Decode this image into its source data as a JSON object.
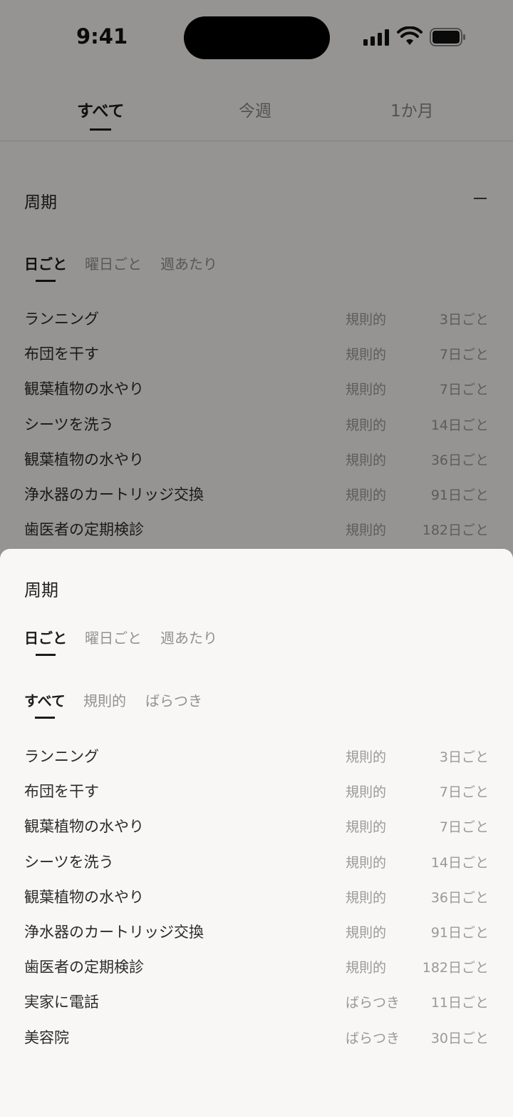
{
  "status_bar": {
    "time": "9:41"
  },
  "top_tabs": [
    {
      "label": "すべて",
      "active": true
    },
    {
      "label": "今週",
      "active": false
    },
    {
      "label": "1か月",
      "active": false
    }
  ],
  "background": {
    "section_title": "周期",
    "sub_tabs": [
      {
        "label": "日ごと",
        "active": true
      },
      {
        "label": "曜日ごと",
        "active": false
      },
      {
        "label": "週あたり",
        "active": false
      }
    ],
    "items": [
      {
        "name": "ランニング",
        "kind": "規則的",
        "interval": "3日ごと"
      },
      {
        "name": "布団を干す",
        "kind": "規則的",
        "interval": "7日ごと"
      },
      {
        "name": "観葉植物の水やり",
        "kind": "規則的",
        "interval": "7日ごと"
      },
      {
        "name": "シーツを洗う",
        "kind": "規則的",
        "interval": "14日ごと"
      },
      {
        "name": "観葉植物の水やり",
        "kind": "規則的",
        "interval": "36日ごと"
      },
      {
        "name": "浄水器のカートリッジ交換",
        "kind": "規則的",
        "interval": "91日ごと"
      },
      {
        "name": "歯医者の定期検診",
        "kind": "規則的",
        "interval": "182日ごと"
      }
    ]
  },
  "sheet": {
    "title": "周期",
    "period_tabs": [
      {
        "label": "日ごと",
        "active": true
      },
      {
        "label": "曜日ごと",
        "active": false
      },
      {
        "label": "週あたり",
        "active": false
      }
    ],
    "filter_tabs": [
      {
        "label": "すべて",
        "active": true
      },
      {
        "label": "規則的",
        "active": false
      },
      {
        "label": "ばらつき",
        "active": false
      }
    ],
    "items": [
      {
        "name": "ランニング",
        "kind": "規則的",
        "interval": "3日ごと"
      },
      {
        "name": "布団を干す",
        "kind": "規則的",
        "interval": "7日ごと"
      },
      {
        "name": "観葉植物の水やり",
        "kind": "規則的",
        "interval": "7日ごと"
      },
      {
        "name": "シーツを洗う",
        "kind": "規則的",
        "interval": "14日ごと"
      },
      {
        "name": "観葉植物の水やり",
        "kind": "規則的",
        "interval": "36日ごと"
      },
      {
        "name": "浄水器のカートリッジ交換",
        "kind": "規則的",
        "interval": "91日ごと"
      },
      {
        "name": "歯医者の定期検診",
        "kind": "規則的",
        "interval": "182日ごと"
      },
      {
        "name": "実家に電話",
        "kind": "ばらつき",
        "interval": "11日ごと"
      },
      {
        "name": "美容院",
        "kind": "ばらつき",
        "interval": "30日ごと"
      }
    ]
  },
  "icons": {
    "signal": "cellular-signal-icon",
    "wifi": "wifi-icon",
    "battery": "battery-icon",
    "collapse": "minus-icon"
  }
}
